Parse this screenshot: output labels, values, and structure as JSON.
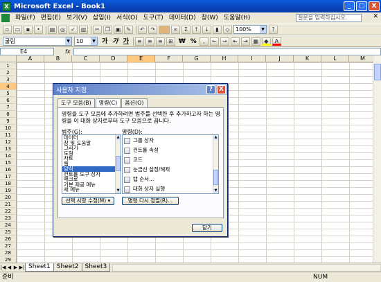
{
  "window": {
    "title": "Microsoft Excel - Book1",
    "minimize": "_",
    "maximize": "□",
    "close": "X"
  },
  "menu": {
    "items": [
      "파일(F)",
      "편집(E)",
      "보기(V)",
      "삽입(I)",
      "서식(O)",
      "도구(T)",
      "데이터(D)",
      "창(W)",
      "도움말(H)"
    ],
    "help_placeholder": "질문을 입력하십시오.",
    "doc_close": "✕"
  },
  "toolbar": {
    "zoom": "100%"
  },
  "format_toolbar": {
    "font_name": "굴림",
    "font_size": "10",
    "bold": "가",
    "italic": "가",
    "underline": "가",
    "currency": "₩",
    "percent": "%"
  },
  "formula_bar": {
    "name_box": "E4",
    "fx": "fx"
  },
  "sheet": {
    "columns": [
      "A",
      "B",
      "C",
      "D",
      "E",
      "F",
      "G",
      "H",
      "I",
      "J",
      "K",
      "L",
      "M"
    ],
    "rows": [
      "1",
      "2",
      "3",
      "4",
      "5",
      "6",
      "7",
      "8",
      "9",
      "10",
      "11",
      "12",
      "13",
      "14",
      "15",
      "16",
      "17",
      "18",
      "19",
      "20",
      "21",
      "22",
      "23",
      "24",
      "25",
      "26",
      "27",
      "28",
      "29"
    ],
    "active_cell": "E4",
    "tabs": [
      "Sheet1",
      "Sheet2",
      "Sheet3"
    ]
  },
  "status": {
    "left": "준비",
    "num": "NUM"
  },
  "dialog": {
    "title": "사용자 지정",
    "help": "?",
    "close": "X",
    "tabs": [
      "도구 모음(B)",
      "명령(C)",
      "옵션(O)"
    ],
    "active_tab": "명령(C)",
    "description": "명령을 도구 모음에 추가하려면 범주를 선택한 후 추가하고자 하는 명령을 이 대화 상자로부터 도구 모음으로 끕니다.",
    "categories_label": "범주(G):",
    "commands_label": "명령(D):",
    "categories": [
      "데이터",
      "창 및 도움말",
      "그리기",
      "도형",
      "차트",
      "웹",
      "양식",
      "컨트롤 도구 상자",
      "매크로",
      "기본 제공 메뉴",
      "새 메뉴"
    ],
    "selected_category": "양식",
    "commands": [
      "그룹 상자",
      "컨트롤 속성",
      "코드",
      "눈금선 설정/해제",
      "탭 순서...",
      "대화 상자 실행"
    ],
    "modify_selection": "선택 사항 수정(M) ▾",
    "rearrange": "명령 다시 정렬(R)...",
    "close_button": "닫기"
  }
}
